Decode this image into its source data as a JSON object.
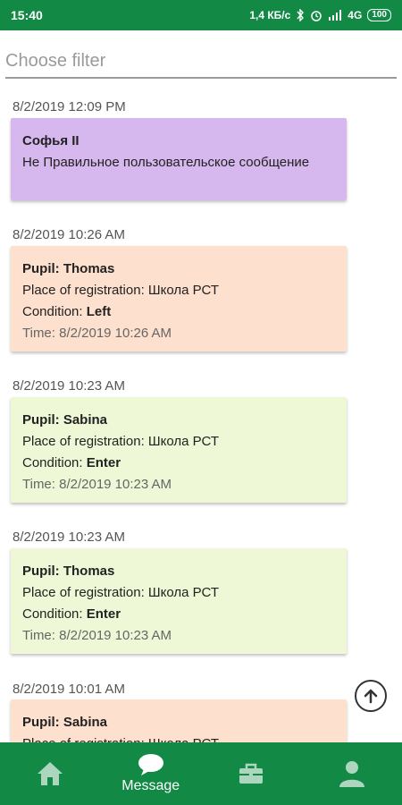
{
  "status": {
    "time": "15:40",
    "net_speed": "1,4 КБ/с",
    "network": "4G",
    "battery": "100"
  },
  "filter": {
    "placeholder": "Choose filter"
  },
  "messages": [
    {
      "date": "8/2/2019 12:09 PM",
      "title": "Софья II",
      "text": "Не Правильное пользовательское сообщение"
    },
    {
      "date": "8/2/2019 10:26 AM",
      "pupil": "Pupil: Thomas",
      "place": "Place of registration: Школа РСТ",
      "condition_label": "Condition: ",
      "condition": "Left",
      "time": "Time: 8/2/2019 10:26 AM"
    },
    {
      "date": "8/2/2019 10:23 AM",
      "pupil": "Pupil: Sabina",
      "place": "Place of registration: Школа РСТ",
      "condition_label": "Condition: ",
      "condition": "Enter",
      "time": "Time: 8/2/2019 10:23 AM"
    },
    {
      "date": "8/2/2019 10:23 AM",
      "pupil": "Pupil: Thomas",
      "place": "Place of registration: Школа РСТ",
      "condition_label": "Condition: ",
      "condition": "Enter",
      "time": "Time: 8/2/2019 10:23 AM"
    },
    {
      "date": "8/2/2019 10:01 AM",
      "pupil": "Pupil: Sabina",
      "place": "Place of registration: Школа РСТ"
    }
  ],
  "colors": {
    "brand": "#128a45",
    "custom_message": "#d6b8ef",
    "left": "#fde0ce",
    "enter": "#eef8d6"
  },
  "nav": [
    {
      "icon": "home-icon",
      "label": ""
    },
    {
      "icon": "message-icon",
      "label": "Message",
      "active": true
    },
    {
      "icon": "briefcase-icon",
      "label": ""
    },
    {
      "icon": "profile-icon",
      "label": ""
    }
  ]
}
